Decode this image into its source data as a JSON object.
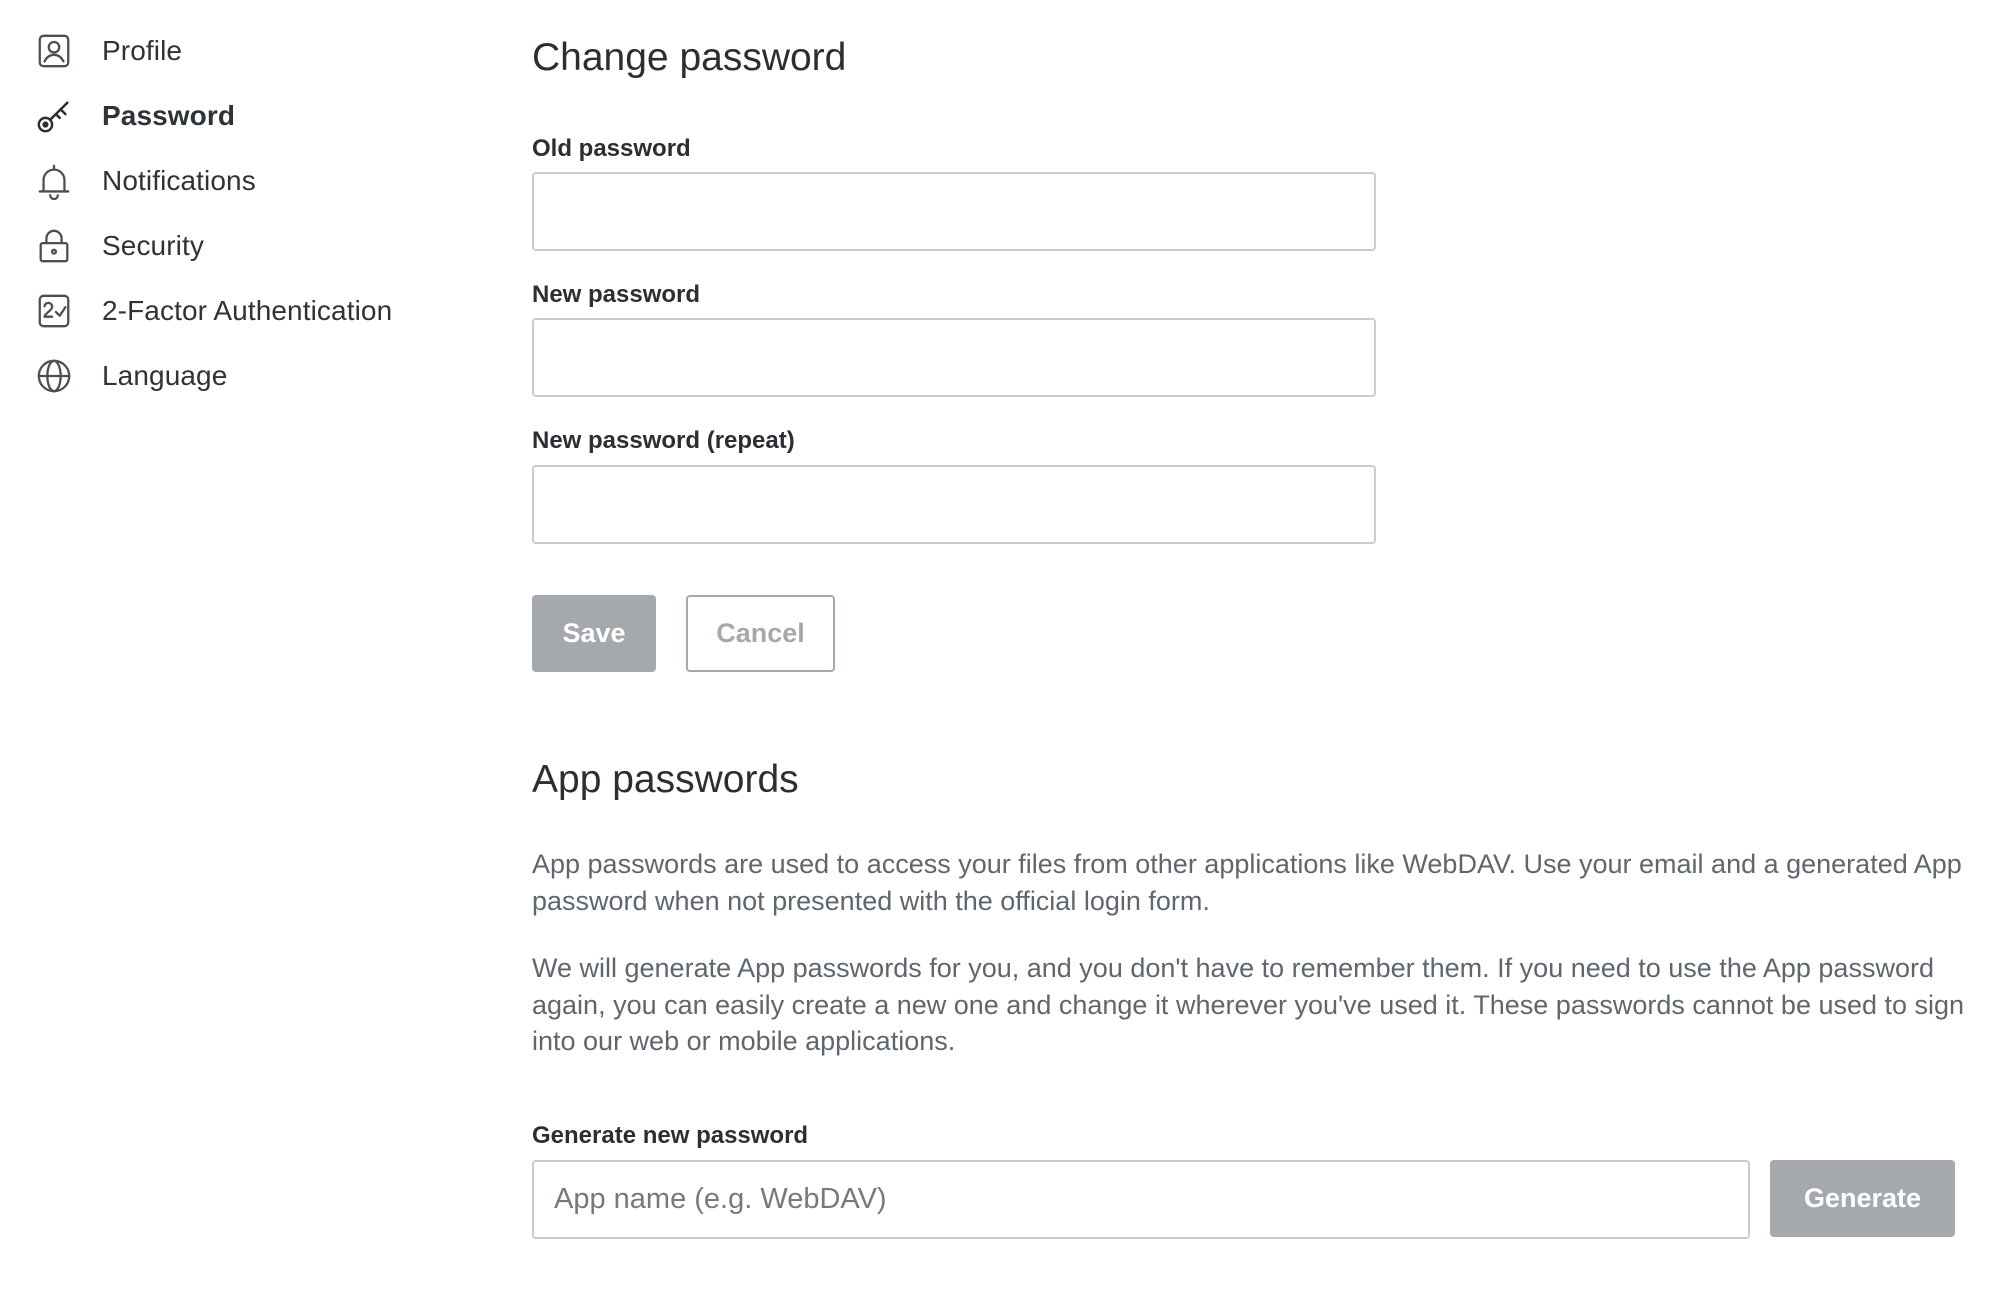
{
  "sidebar": {
    "items": [
      {
        "label": "Profile",
        "icon": "profile-icon",
        "active": false
      },
      {
        "label": "Password",
        "icon": "key-icon",
        "active": true
      },
      {
        "label": "Notifications",
        "icon": "bell-icon",
        "active": false
      },
      {
        "label": "Security",
        "icon": "lock-icon",
        "active": false
      },
      {
        "label": "2-Factor Authentication",
        "icon": "two-factor-icon",
        "active": false
      },
      {
        "label": "Language",
        "icon": "globe-icon",
        "active": false
      }
    ]
  },
  "change_password": {
    "title": "Change password",
    "old_password_label": "Old password",
    "old_password_value": "",
    "new_password_label": "New password",
    "new_password_value": "",
    "repeat_password_label": "New password (repeat)",
    "repeat_password_value": "",
    "save_label": "Save",
    "cancel_label": "Cancel"
  },
  "app_passwords": {
    "title": "App passwords",
    "description_1": "App passwords are used to access your files from other applications like WebDAV. Use your email and a generated App password when not presented with the official login form.",
    "description_2": "We will generate App passwords for you, and you don't have to remember them. If you need to use the App password again, you can easily create a new one and change it wherever you've used it. These passwords cannot be used to sign into our web or mobile applications.",
    "generate_label": "Generate new password",
    "app_name_placeholder": "App name (e.g. WebDAV)",
    "app_name_value": "",
    "generate_button_label": "Generate"
  },
  "colors": {
    "text": "#2b2f33",
    "muted_text": "#5f666d",
    "input_border": "#c8cdd2",
    "disabled_button": "#a5a9ad"
  }
}
